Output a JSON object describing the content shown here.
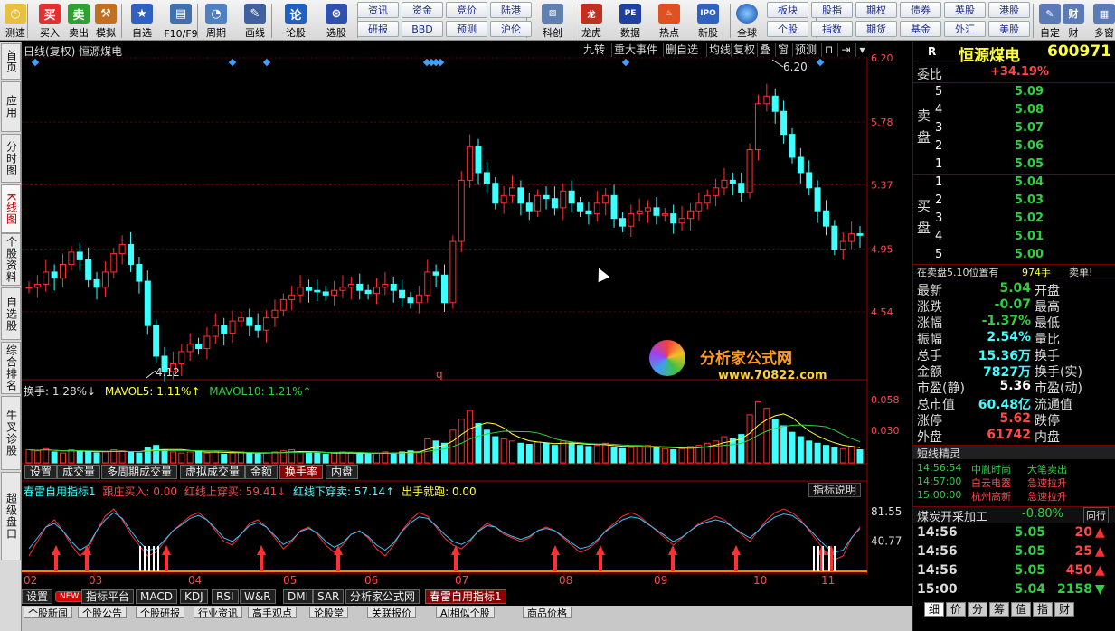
{
  "toolbar": {
    "buttons": [
      {
        "label": "测速",
        "icon": "clock-icon",
        "sym": "◷",
        "bg": "#e8c040"
      },
      {
        "label": "买入",
        "icon": "buy-icon",
        "sym": "买",
        "bg": "#e03030"
      },
      {
        "label": "卖出",
        "icon": "sell-icon",
        "sym": "卖",
        "bg": "#30a030"
      },
      {
        "label": "模拟",
        "icon": "hammer-icon",
        "sym": "⚒",
        "bg": "#c07020"
      },
      {
        "label": "自选",
        "icon": "star-icon",
        "sym": "★",
        "bg": "#3060c0"
      },
      {
        "label": "F10/F9",
        "icon": "window-icon",
        "sym": "▤",
        "bg": "#4070b0"
      },
      {
        "label": "周期",
        "icon": "clock-period-icon",
        "sym": "◔",
        "bg": "#5080c0"
      },
      {
        "label": "画线",
        "icon": "pen-icon",
        "sym": "✎",
        "bg": "#4060a0"
      },
      {
        "label": "论股",
        "icon": "discuss-icon",
        "sym": "论",
        "bg": "#2060c0"
      },
      {
        "label": "选股",
        "icon": "select-stock-icon",
        "sym": "⊛",
        "bg": "#3050b0"
      }
    ],
    "pills_top": [
      "资讯",
      "资金",
      "竞价",
      "陆港"
    ],
    "pills_bottom": [
      "研报",
      "BBD",
      "预测",
      "沪伦"
    ],
    "buttons2": [
      {
        "label": "科创",
        "icon": "chart-icon",
        "sym": "▨",
        "bg": "#6080b0"
      },
      {
        "label": "龙虎",
        "icon": "dragon-icon",
        "sym": "龙",
        "bg": "#c03020"
      },
      {
        "label": "数据",
        "icon": "pe-icon",
        "sym": "PE",
        "bg": "#2040a0"
      },
      {
        "label": "热点",
        "icon": "hot-icon",
        "sym": "♨",
        "bg": "#e05020"
      },
      {
        "label": "新股",
        "icon": "ipo-icon",
        "sym": "IPO",
        "bg": "#3060c0"
      }
    ],
    "globe": {
      "label": "全球",
      "icon": "globe-icon"
    },
    "right_pills_top": [
      "板块",
      "股指",
      "期权",
      "债券",
      "英股",
      "港股"
    ],
    "right_pills_bottom": [
      "个股",
      "指数",
      "期货",
      "基金",
      "外汇",
      "美股"
    ],
    "end_buttons": [
      {
        "label": "自定",
        "icon": "custom-icon",
        "sym": "✎"
      },
      {
        "label": "财",
        "icon": "finance-icon",
        "sym": "财"
      },
      {
        "label": "多窗",
        "icon": "multiwindow-icon",
        "sym": "▦"
      }
    ]
  },
  "left_tabs": [
    "首页",
    "应用",
    "分时图",
    "K线图",
    "个股资料",
    "自选股",
    "综合排名",
    "牛叉诊股",
    "超级盘口"
  ],
  "chart_header": {
    "title": "日线(复权) 恒源煤电",
    "buttons": [
      "九转",
      "重大事件",
      "删自选",
      "均线",
      "复权",
      "叠",
      "窗",
      "预测"
    ]
  },
  "price_axis": [
    "6.20",
    "5.78",
    "5.37",
    "4.95",
    "4.54"
  ],
  "annotations": {
    "high": "6.20",
    "low": "4.12",
    "q_marker": "q"
  },
  "volume_header": {
    "hs": "换手: 1.28%↓",
    "ma5": "MAVOL5: 1.11%↑",
    "ma10": "MAVOL10: 1.21%↑"
  },
  "volume_axis": [
    "0.058",
    "0.030"
  ],
  "sub_tabs": [
    "设置",
    "成交量",
    "多周期成交量",
    "虚拟成交量",
    "金额",
    "换手率",
    "内盘"
  ],
  "indicator_header": {
    "name": "春雷自用指标1",
    "buy": "跟庄买入: 0.00",
    "up": "红线上穿买: 59.41↓",
    "down": "红线下穿卖: 57.14↑",
    "exit": "出手就跑: 0.00",
    "help": "指标说明"
  },
  "indicator_axis": [
    "81.55",
    "40.77"
  ],
  "x_axis": [
    "02",
    "03",
    "04",
    "05",
    "06",
    "07",
    "08",
    "09",
    "10",
    "11"
  ],
  "formula_tabs": [
    "设置",
    "NEW",
    "指标平台",
    "MACD",
    "KDJ",
    "RSI",
    "W&R",
    "DMI",
    "SAR",
    "分析家公式网",
    "春雷自用指标1"
  ],
  "bottom_tabs": [
    "个股新闻",
    "个股公告",
    "个股研报",
    "行业资讯",
    "高手观点",
    "论股堂",
    "关联报价",
    "AI相似个股",
    "商品价格"
  ],
  "watermark": {
    "title": "分析家公式网",
    "url": "www.70822.com"
  },
  "quote": {
    "r": "R",
    "name": "恒源煤电",
    "code": "600971",
    "weibi_label": "委比",
    "weibi": "+34.19%",
    "sell_label": "卖盘",
    "sell": [
      {
        "n": "5",
        "p": "5.09"
      },
      {
        "n": "4",
        "p": "5.08"
      },
      {
        "n": "3",
        "p": "5.07"
      },
      {
        "n": "2",
        "p": "5.06"
      },
      {
        "n": "1",
        "p": "5.05"
      }
    ],
    "buy_label": "买盘",
    "buy": [
      {
        "n": "1",
        "p": "5.04"
      },
      {
        "n": "2",
        "p": "5.03"
      },
      {
        "n": "3",
        "p": "5.02"
      },
      {
        "n": "4",
        "p": "5.01"
      },
      {
        "n": "5",
        "p": "5.00"
      }
    ],
    "notice": "在卖盘5.10位置有",
    "notice_vol": "974手",
    "notice_end": "卖单!",
    "stats": [
      {
        "l": "最新",
        "v": "5.04",
        "c": "green",
        "r": "开盘"
      },
      {
        "l": "涨跌",
        "v": "-0.07",
        "c": "green",
        "r": "最高"
      },
      {
        "l": "涨幅",
        "v": "-1.37%",
        "c": "green",
        "r": "最低"
      },
      {
        "l": "振幅",
        "v": "2.54%",
        "c": "cyan",
        "r": "量比"
      },
      {
        "l": "总手",
        "v": "15.36万",
        "c": "cyan",
        "r": "换手"
      },
      {
        "l": "金额",
        "v": "7827万",
        "c": "cyan",
        "r": "换手(实)"
      },
      {
        "l": "市盈(静)",
        "v": "5.36",
        "c": "white",
        "r": "市盈(动)"
      },
      {
        "l": "总市值",
        "v": "60.48亿",
        "c": "cyan",
        "r": "流通值"
      },
      {
        "l": "涨停",
        "v": "5.62",
        "c": "red",
        "r": "跌停"
      },
      {
        "l": "外盘",
        "v": "61742",
        "c": "red",
        "r": "内盘"
      }
    ],
    "spirit_title": "短线精灵",
    "spirit": [
      {
        "t": "14:56:54",
        "s": "中胤时尚",
        "e": "大笔卖出"
      },
      {
        "t": "14:57:00",
        "s": "白云电器",
        "e": "急速拉升"
      },
      {
        "t": "15:00:00",
        "s": "杭州高新",
        "e": "急速拉升"
      }
    ],
    "industry": {
      "name": "煤炭开采加工",
      "chg": "-0.80%",
      "btn": "同行"
    },
    "ticks": [
      {
        "t": "14:56",
        "p": "5.05",
        "v": "20",
        "d": "up"
      },
      {
        "t": "14:56",
        "p": "5.05",
        "v": "25",
        "d": "up"
      },
      {
        "t": "14:56",
        "p": "5.05",
        "v": "450",
        "d": "up"
      },
      {
        "t": "15:00",
        "p": "5.04",
        "v": "2158",
        "d": "down"
      }
    ],
    "bottom_tabs": [
      "细",
      "价",
      "分",
      "筹",
      "值",
      "指",
      "财"
    ]
  },
  "colors": {
    "up": "#ff3030",
    "down": "#40ffff",
    "axis": "#a00000",
    "ma": "#ffff40"
  },
  "chart_data": [
    {
      "type": "line",
      "title": "日线(复权) 恒源煤电",
      "ylim": [
        4.12,
        6.2
      ],
      "series": [
        {
          "name": "恒源煤电",
          "values": [
            4.7,
            4.72,
            4.8,
            4.76,
            4.85,
            4.93,
            4.88,
            4.75,
            4.7,
            4.8,
            4.92,
            4.98,
            4.85,
            4.74,
            4.45,
            4.25,
            4.15,
            4.2,
            4.28,
            4.33,
            4.3,
            4.38,
            4.45,
            4.4,
            4.48,
            4.5,
            4.45,
            4.42,
            4.5,
            4.55,
            4.62,
            4.65,
            4.7,
            4.68,
            4.67,
            4.65,
            4.68,
            4.7,
            4.72,
            4.68,
            4.66,
            4.7,
            4.72,
            4.68,
            4.63,
            4.6,
            4.65,
            4.8,
            4.78,
            4.6,
            5.0,
            5.4,
            5.62,
            5.45,
            5.38,
            5.25,
            5.3,
            5.35,
            5.25,
            5.2,
            5.3,
            5.28,
            5.22,
            5.33,
            5.25,
            5.2,
            5.18,
            5.25,
            5.3,
            5.15,
            5.1,
            5.18,
            5.2,
            5.22,
            5.17,
            5.18,
            5.12,
            5.15,
            5.2,
            5.25,
            5.3,
            5.35,
            5.4,
            5.38,
            5.32,
            5.6,
            5.9,
            5.95,
            5.85,
            5.7,
            5.55,
            5.45,
            5.35,
            5.2,
            5.1,
            4.95,
            5.0,
            5.05,
            5.04
          ]
        }
      ]
    },
    {
      "type": "bar",
      "title": "换手率",
      "ylim": [
        0,
        0.058
      ],
      "series": [
        {
          "name": "换手",
          "values": [
            0.012,
            0.011,
            0.013,
            0.01,
            0.009,
            0.012,
            0.011,
            0.01,
            0.009,
            0.01,
            0.012,
            0.011,
            0.01,
            0.009,
            0.014,
            0.016,
            0.012,
            0.01,
            0.009,
            0.01,
            0.011,
            0.009,
            0.01,
            0.008,
            0.009,
            0.01,
            0.009,
            0.008,
            0.009,
            0.01,
            0.011,
            0.012,
            0.01,
            0.009,
            0.009,
            0.008,
            0.009,
            0.01,
            0.009,
            0.008,
            0.008,
            0.009,
            0.01,
            0.009,
            0.01,
            0.011,
            0.01,
            0.022,
            0.02,
            0.018,
            0.03,
            0.04,
            0.048,
            0.036,
            0.03,
            0.024,
            0.022,
            0.02,
            0.018,
            0.017,
            0.019,
            0.018,
            0.016,
            0.02,
            0.018,
            0.016,
            0.015,
            0.016,
            0.018,
            0.014,
            0.013,
            0.014,
            0.015,
            0.016,
            0.014,
            0.013,
            0.012,
            0.013,
            0.015,
            0.016,
            0.018,
            0.02,
            0.024,
            0.022,
            0.026,
            0.044,
            0.056,
            0.05,
            0.04,
            0.034,
            0.028,
            0.024,
            0.02,
            0.018,
            0.016,
            0.014,
            0.013,
            0.015,
            0.012
          ]
        }
      ]
    },
    {
      "type": "line",
      "title": "春雷自用指标1",
      "ylim": [
        0,
        100
      ],
      "series": [
        {
          "name": "红线",
          "values": [
            20,
            40,
            60,
            70,
            55,
            35,
            20,
            30,
            55,
            75,
            85,
            70,
            50,
            35,
            20,
            25,
            40,
            55,
            65,
            75,
            80,
            70,
            55,
            40,
            35,
            50,
            65,
            70,
            60,
            45,
            30,
            40,
            55,
            60,
            50,
            35,
            25,
            35,
            50,
            55,
            45,
            30,
            20,
            35,
            55,
            70,
            80,
            75,
            60,
            45,
            35,
            30,
            40,
            55,
            65,
            60,
            50,
            45,
            40,
            45,
            55,
            60,
            55,
            45,
            35,
            25,
            30,
            40,
            55,
            65,
            75,
            80,
            75,
            65,
            55,
            45,
            35,
            45,
            55,
            65,
            70,
            75,
            70,
            60,
            50,
            40,
            55,
            70,
            80,
            85,
            80,
            70,
            55,
            40,
            25,
            15,
            20,
            45,
            60
          ]
        },
        {
          "name": "蓝线",
          "values": [
            30,
            45,
            60,
            65,
            55,
            40,
            28,
            35,
            55,
            70,
            80,
            72,
            55,
            40,
            28,
            30,
            42,
            55,
            63,
            72,
            76,
            70,
            58,
            45,
            40,
            50,
            62,
            66,
            60,
            48,
            36,
            42,
            54,
            58,
            52,
            40,
            32,
            38,
            50,
            54,
            47,
            35,
            28,
            38,
            54,
            66,
            74,
            72,
            62,
            50,
            40,
            36,
            42,
            54,
            62,
            60,
            52,
            47,
            43,
            47,
            55,
            58,
            55,
            47,
            38,
            30,
            33,
            42,
            54,
            62,
            70,
            74,
            72,
            64,
            56,
            48,
            40,
            46,
            55,
            63,
            67,
            70,
            67,
            60,
            52,
            45,
            55,
            66,
            74,
            78,
            76,
            68,
            57,
            45,
            33,
            25,
            28,
            45,
            58
          ]
        }
      ]
    }
  ]
}
